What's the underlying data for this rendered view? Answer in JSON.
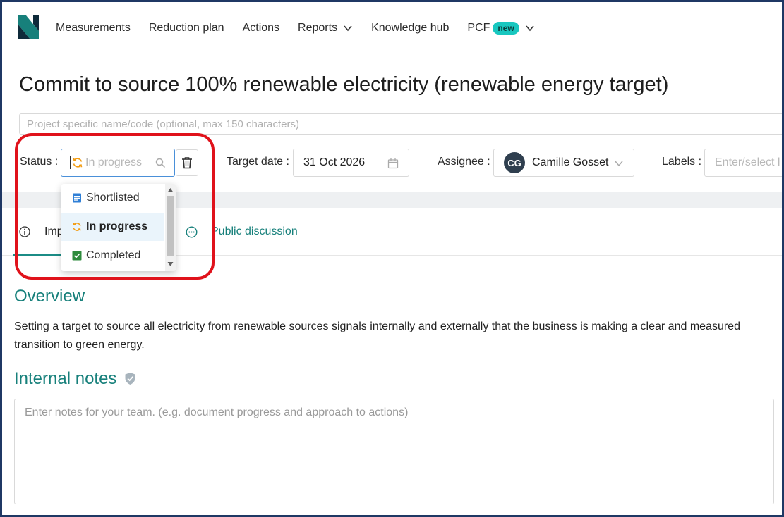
{
  "nav": {
    "items": [
      {
        "label": "Measurements"
      },
      {
        "label": "Reduction plan"
      },
      {
        "label": "Actions"
      },
      {
        "label": "Reports"
      },
      {
        "label": "Knowledge hub"
      },
      {
        "label": "PCF"
      }
    ],
    "pcf_badge": "new"
  },
  "action": {
    "title": "Commit to source 100% renewable electricity (renewable energy target)",
    "project_placeholder": "Project specific name/code (optional, max 150 characters)"
  },
  "fields": {
    "status_label": "Status",
    "status_placeholder": "In progress",
    "target_date_label": "Target date",
    "target_date_value": "31 Oct 2026",
    "assignee_label": "Assignee",
    "assignee_initials": "CG",
    "assignee_name": "Camille Gosset",
    "labels_label": "Labels",
    "labels_placeholder": "Enter/select l"
  },
  "status_options": [
    {
      "label": "Shortlisted",
      "icon": "clipboard-icon",
      "color": "#2f7fd6"
    },
    {
      "label": "In progress",
      "icon": "sync-icon",
      "color": "#f39c12",
      "selected": true
    },
    {
      "label": "Completed",
      "icon": "check-box-icon",
      "color": "#2e8b3d"
    }
  ],
  "tabs": [
    {
      "label": "Imp"
    },
    {
      "label": "Public discussion"
    }
  ],
  "overview": {
    "heading": "Overview",
    "text": "Setting a target to source all electricity from renewable sources signals internally and externally that the business is making a clear and measured transition to green energy."
  },
  "internal_notes": {
    "heading": "Internal notes",
    "placeholder": "Enter notes for your team. (e.g. document progress and approach to actions)"
  },
  "colors": {
    "accent": "#17807b",
    "highlight": "#e0121b",
    "badge": "#18c7bf",
    "focus": "#4a90d9"
  }
}
